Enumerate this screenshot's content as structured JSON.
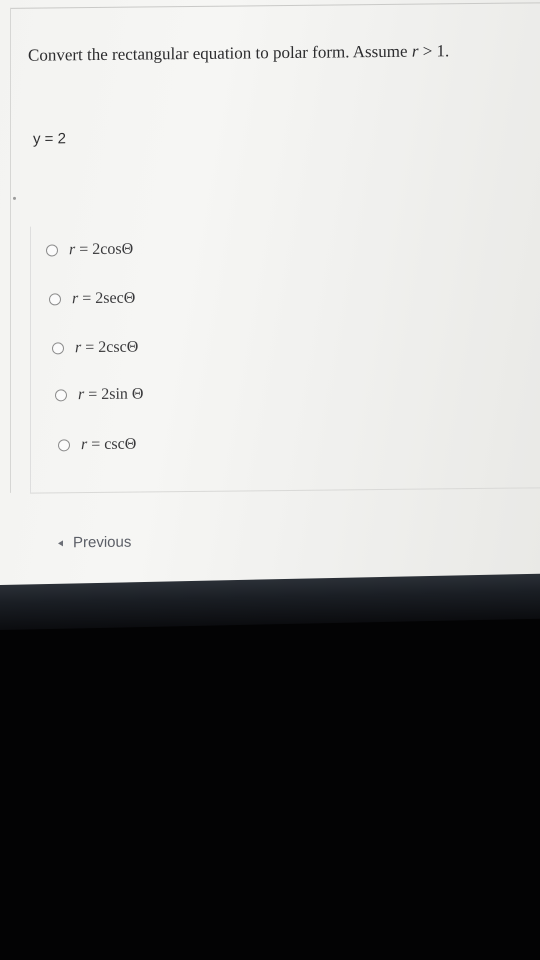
{
  "question": {
    "text": "Convert the rectangular equation to polar form. Assume ",
    "condition_var": "r",
    "condition_rest": " > 1."
  },
  "equation": "y = 2",
  "options": [
    {
      "var": "r",
      "rest": " = 2cosΘ"
    },
    {
      "var": "r",
      "rest": " = 2secΘ"
    },
    {
      "var": "r",
      "rest": " = 2cscΘ"
    },
    {
      "var": "r",
      "rest": " = 2sin Θ"
    },
    {
      "var": "r",
      "rest": " = cscΘ"
    }
  ],
  "navigation": {
    "previous_label": "Previous",
    "previous_icon": "chevron-left-icon"
  }
}
